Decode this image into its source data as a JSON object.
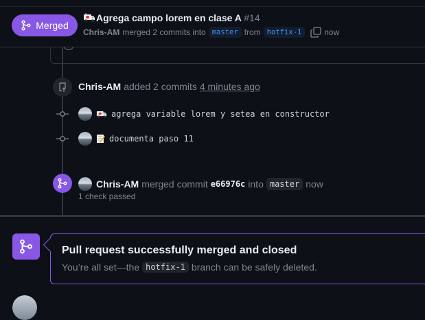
{
  "header": {
    "status_label": "Merged",
    "title": "Agrega campo lorem en clase A",
    "number": "#14",
    "author": "Chris-AM",
    "merged_text": "merged 2 commits into",
    "base_branch": "master",
    "from_text": "from",
    "head_branch": "hotfix-1",
    "time": "now"
  },
  "timeline": {
    "commits_event": {
      "author": "Chris-AM",
      "action": "added 2 commits",
      "time": "4 minutes ago"
    },
    "commits": [
      {
        "emoji": "ambulance",
        "message": "agrega variable lorem y setea en constructor"
      },
      {
        "emoji": "memo",
        "message": "documenta paso 11"
      }
    ],
    "merge_event": {
      "author": "Chris-AM",
      "action": "merged commit",
      "sha": "e66976c",
      "into_text": "into",
      "branch": "master",
      "time": "now",
      "checks": "1 check passed"
    }
  },
  "merge_box": {
    "title": "Pull request successfully merged and closed",
    "desc_before": "You’re all set—the",
    "branch": "hotfix-1",
    "desc_after": "branch can be safely deleted."
  },
  "colors": {
    "merged_purple": "#8957e5",
    "background": "#0d1117",
    "muted_text": "#7d8590",
    "branch_blue": "#4493f8"
  }
}
